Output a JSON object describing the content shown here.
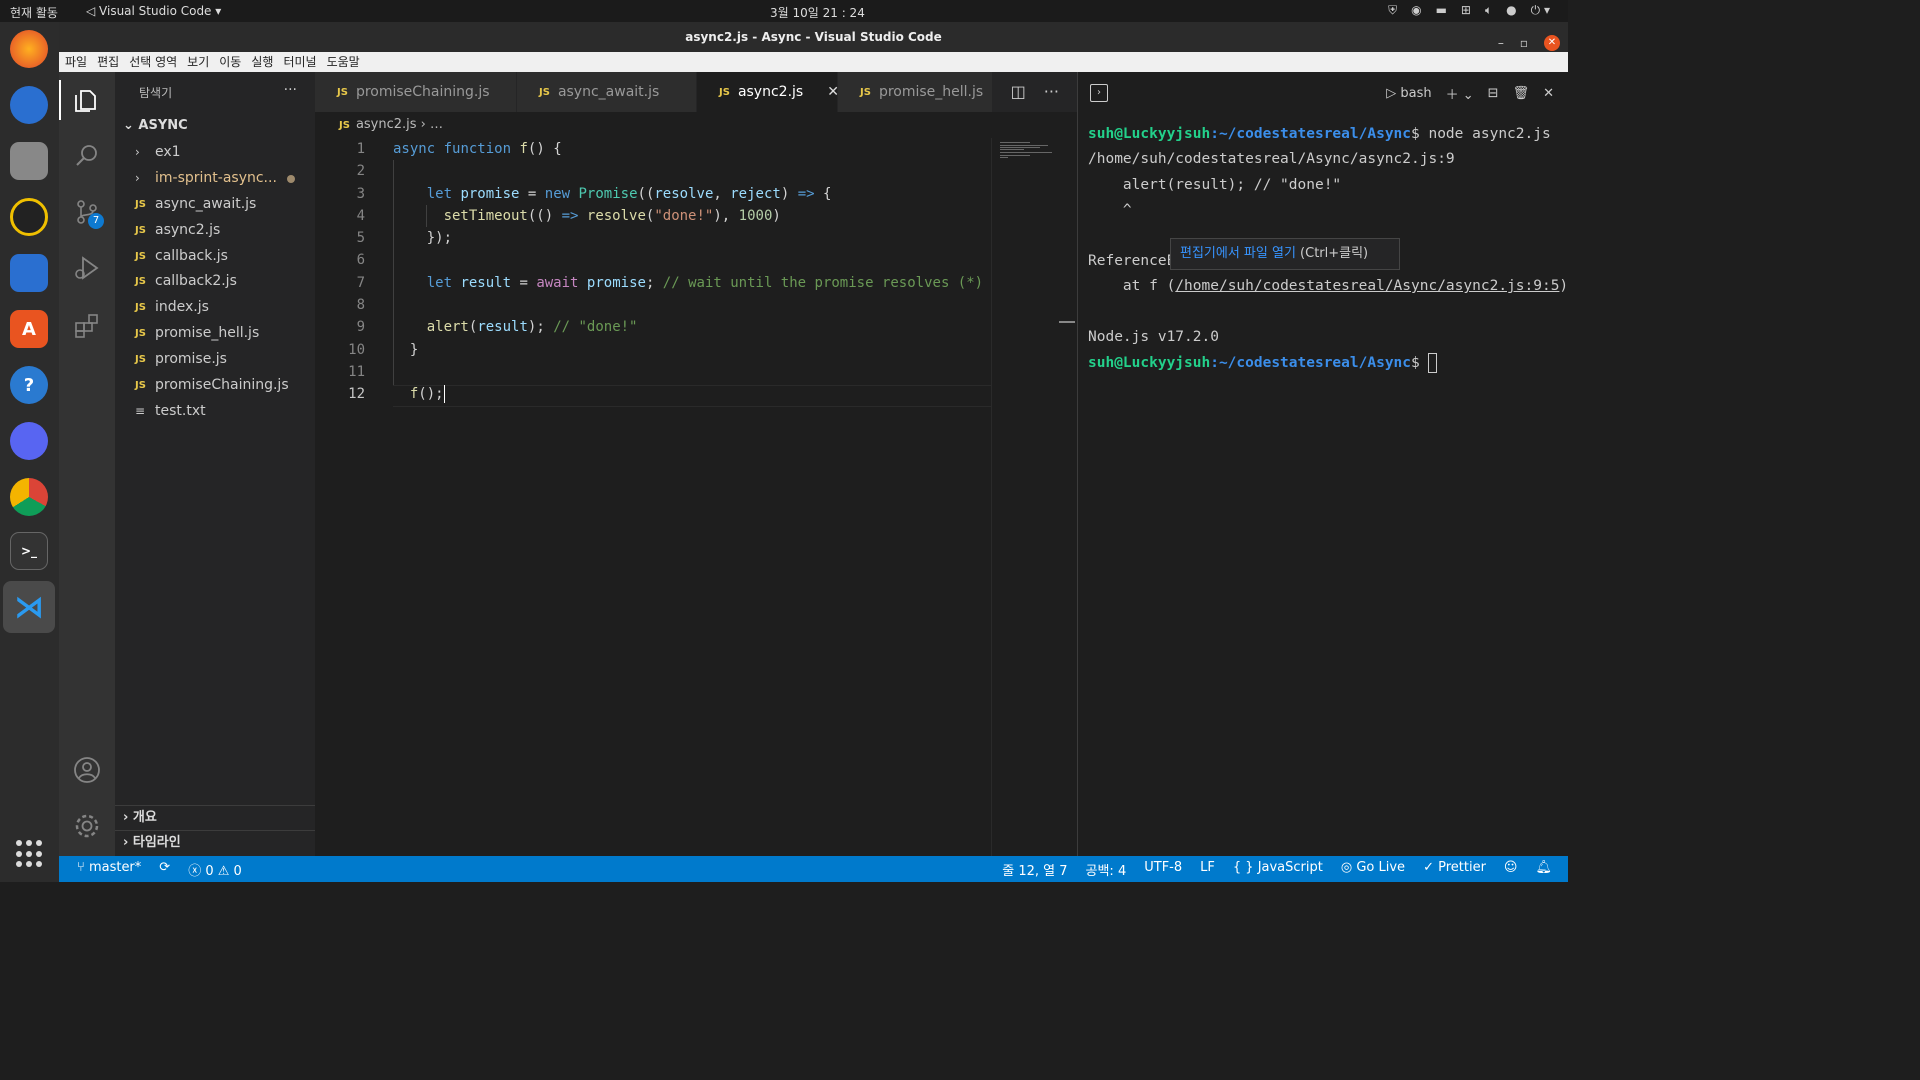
{
  "system": {
    "activities": "현재 활동",
    "app_name": "Visual Studio Code",
    "clock": "3월 10일 21 : 24"
  },
  "window": {
    "title": "async2.js - Async - Visual Studio Code"
  },
  "menu": [
    "파일",
    "편집",
    "선택 영역",
    "보기",
    "이동",
    "실행",
    "터미널",
    "도움말"
  ],
  "activity_bar": {
    "source_control_badge": "7"
  },
  "explorer": {
    "header": "탐색기",
    "root": "ASYNC",
    "items": [
      {
        "label": "ex1",
        "kind": "folder"
      },
      {
        "label": "im-sprint-async...",
        "kind": "folder-modified"
      },
      {
        "label": "async_await.js",
        "kind": "js"
      },
      {
        "label": "async2.js",
        "kind": "js"
      },
      {
        "label": "callback.js",
        "kind": "js"
      },
      {
        "label": "callback2.js",
        "kind": "js"
      },
      {
        "label": "index.js",
        "kind": "js"
      },
      {
        "label": "promise_hell.js",
        "kind": "js"
      },
      {
        "label": "promise.js",
        "kind": "js"
      },
      {
        "label": "promiseChaining.js",
        "kind": "js"
      },
      {
        "label": "test.txt",
        "kind": "txt"
      }
    ],
    "sections": [
      "개요",
      "타임라인"
    ]
  },
  "tabs": [
    {
      "label": "promiseChaining.js",
      "active": false
    },
    {
      "label": "async_await.js",
      "active": false
    },
    {
      "label": "async2.js",
      "active": true
    },
    {
      "label": "promise_hell.js",
      "active": false
    }
  ],
  "breadcrumb": {
    "file": "async2.js",
    "rest": "…"
  },
  "editor": {
    "current_line": 12,
    "line_numbers": [
      "1",
      "2",
      "3",
      "4",
      "5",
      "6",
      "7",
      "8",
      "9",
      "10",
      "11",
      "12"
    ]
  },
  "terminal": {
    "shell": "bash",
    "prompt_user": "suh@Luckyyjsuh",
    "prompt_path": ":~/codestatesreal/Async",
    "command": "$ node async2.js",
    "lines": [
      "/home/suh/codestatesreal/Async/async2.js:9",
      "    alert(result); // \"done!\"",
      "    ^",
      "",
      "ReferenceE"
    ],
    "at_prefix": "    at f (",
    "at_link": "/home/suh/codestatesreal/Async/async2.js:9:5",
    "at_suffix": ")",
    "node_version": "Node.js v17.2.0",
    "prompt_end": "$ "
  },
  "tooltip": {
    "link_text": "편집기에서 파일 열기",
    "hint": " (Ctrl+클릭)"
  },
  "status": {
    "branch": "master*",
    "errors": "0",
    "warnings": "0",
    "position": "줄 12, 열 7",
    "spaces": "공백: 4",
    "encoding": "UTF-8",
    "eol": "LF",
    "language": "JavaScript",
    "golive": "Go Live",
    "prettier": "Prettier"
  },
  "colors": {
    "status_bar": "#007acc",
    "editor_bg": "#1e1e1e",
    "prompt_green": "#23d18b",
    "prompt_blue": "#3b8eea"
  }
}
